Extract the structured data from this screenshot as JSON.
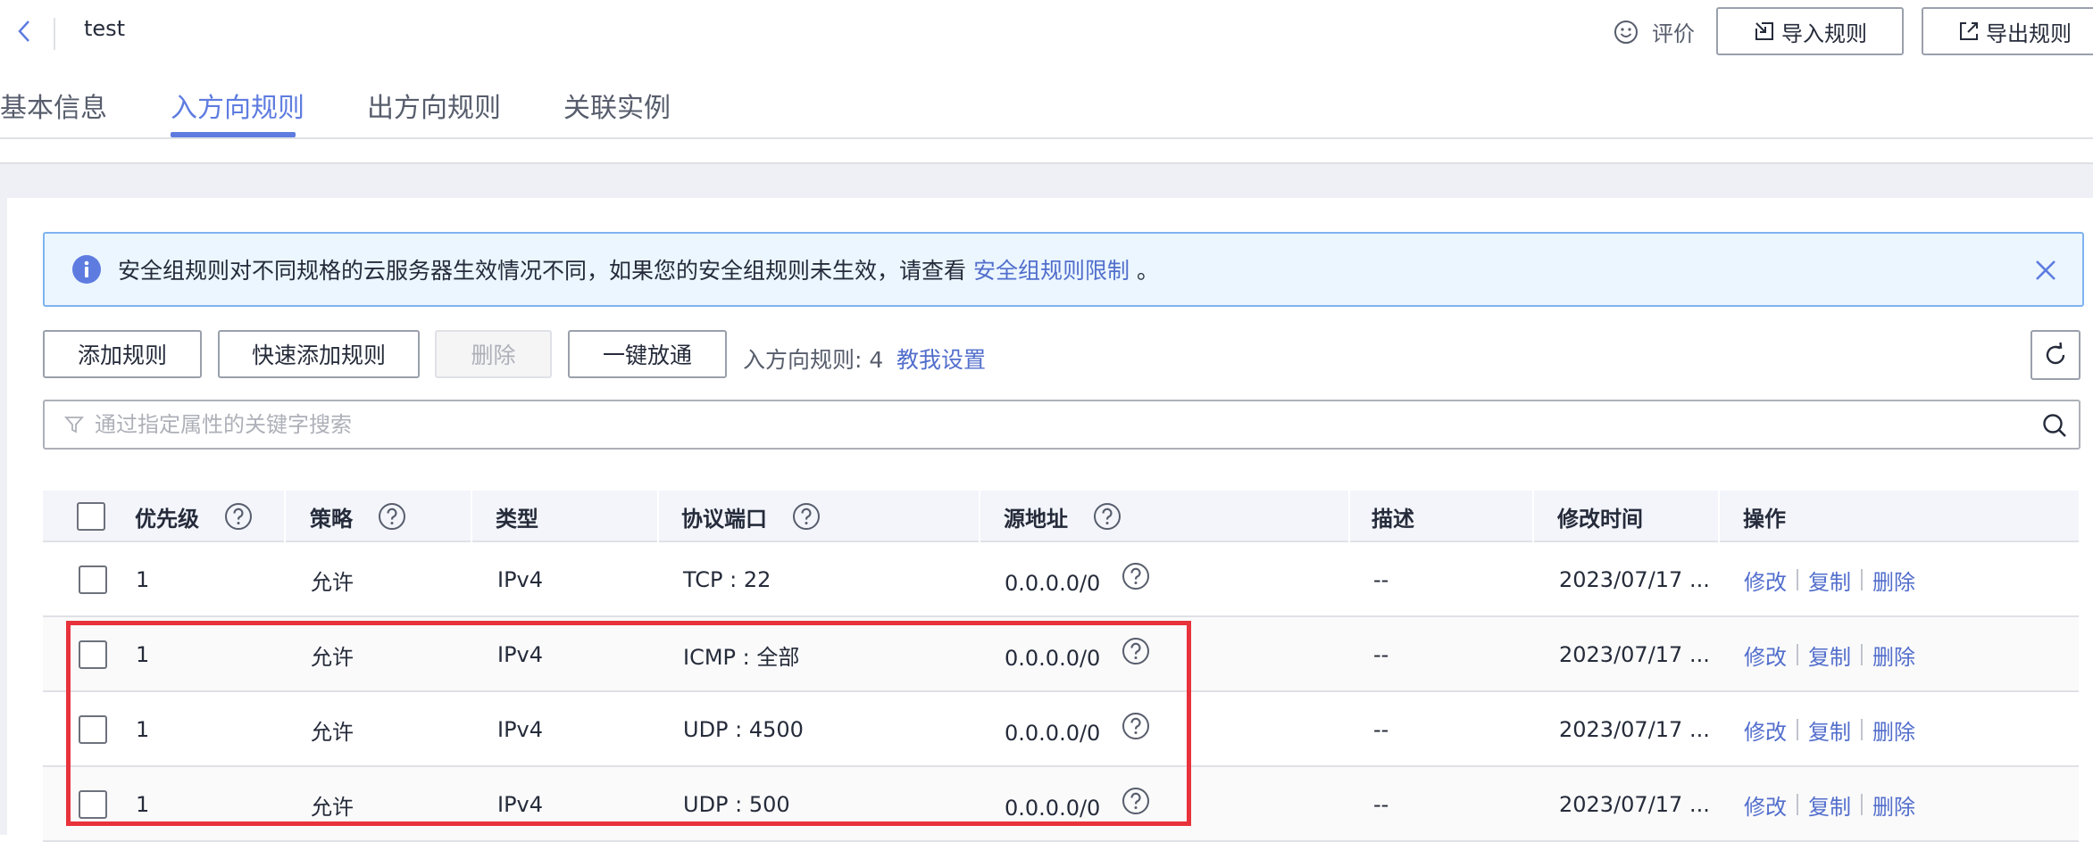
{
  "header": {
    "title": "test",
    "rate_label": "评价",
    "import_label": "导入规则",
    "export_label": "导出规则"
  },
  "tabs": [
    {
      "label": "基本信息",
      "active": false
    },
    {
      "label": "入方向规则",
      "active": true
    },
    {
      "label": "出方向规则",
      "active": false
    },
    {
      "label": "关联实例",
      "active": false
    }
  ],
  "alert": {
    "text": "安全组规则对不同规格的云服务器生效情况不同，如果您的安全组规则未生效，请查看",
    "link": "安全组规则限制",
    "tail": "。"
  },
  "toolbar": {
    "add_label": "添加规则",
    "quick_add_label": "快速添加规则",
    "delete_label": "删除",
    "open_label": "一键放通",
    "rule_count_text": "入方向规则: 4",
    "teach_link": "教我设置"
  },
  "search": {
    "placeholder": "通过指定属性的关键字搜索",
    "value": ""
  },
  "table": {
    "columns": [
      "优先级",
      "策略",
      "类型",
      "协议端口",
      "源地址",
      "描述",
      "修改时间",
      "操作"
    ],
    "rows": [
      {
        "priority": "1",
        "policy": "允许",
        "type": "IPv4",
        "port": "TCP : 22",
        "source": "0.0.0.0/0",
        "desc": "--",
        "time": "2023/07/17 ..."
      },
      {
        "priority": "1",
        "policy": "允许",
        "type": "IPv4",
        "port": "ICMP : 全部",
        "source": "0.0.0.0/0",
        "desc": "--",
        "time": "2023/07/17 ..."
      },
      {
        "priority": "1",
        "policy": "允许",
        "type": "IPv4",
        "port": "UDP : 4500",
        "source": "0.0.0.0/0",
        "desc": "--",
        "time": "2023/07/17 ..."
      },
      {
        "priority": "1",
        "policy": "允许",
        "type": "IPv4",
        "port": "UDP : 500",
        "source": "0.0.0.0/0",
        "desc": "--",
        "time": "2023/07/17 ..."
      }
    ],
    "row_actions": {
      "edit": "修改",
      "copy": "复制",
      "delete": "删除"
    }
  },
  "colors": {
    "accent": "#5e7ce0",
    "link": "#526ecc",
    "alert_bg": "#ebf6ff",
    "highlight": "#e8323c"
  }
}
